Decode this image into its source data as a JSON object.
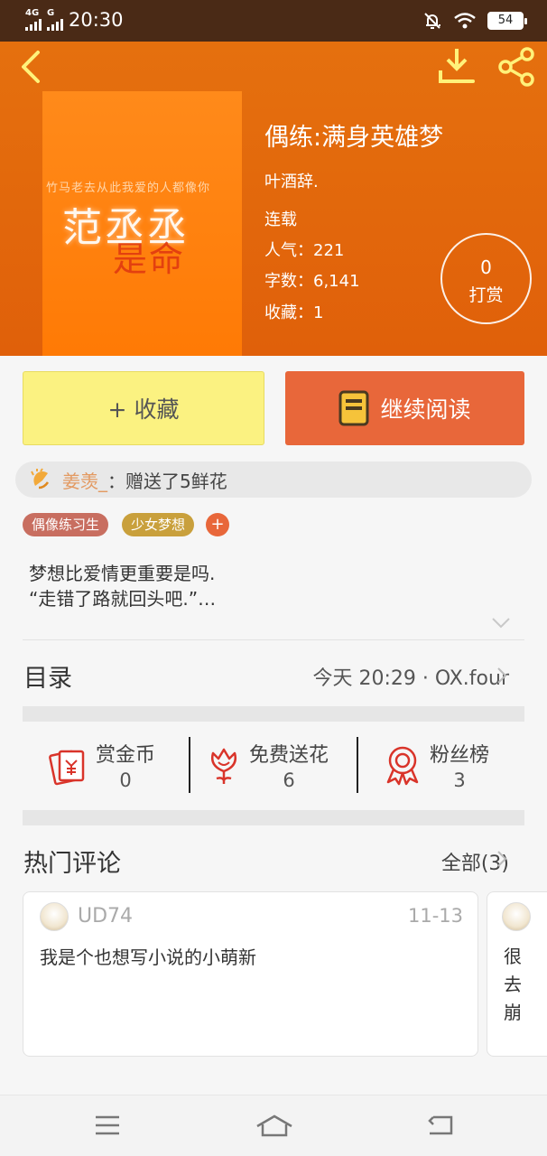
{
  "status_bar": {
    "network_1": "4G",
    "network_2": "G",
    "time": "20:30",
    "battery": "54"
  },
  "book": {
    "cover": {
      "sub_text": "竹马老去从此我爱的人都像你",
      "main_text": "范丞丞",
      "red_text": "是命"
    },
    "title": "偶练:满身英雄梦",
    "author": "叶酒辞.",
    "status": "连载",
    "popularity": "人气：221",
    "word_count": "字数：6,141",
    "favorites": "收藏：1",
    "reward": {
      "count": "0",
      "label": "打赏"
    }
  },
  "actions": {
    "favorite_label": "+ 收藏",
    "read_label": "继续阅读"
  },
  "gift_strip": {
    "user": "姜羡_",
    "text": "：赠送了5鲜花"
  },
  "tags": [
    {
      "label": "偶像练习生",
      "color": "#c86e60"
    },
    {
      "label": "少女梦想",
      "color": "#c9a03c"
    }
  ],
  "tag_add": "+",
  "intro": {
    "line1": "梦想比爱情更重要是吗.",
    "line2": "“走错了路就回头吧.”…"
  },
  "toc": {
    "title": "目录",
    "latest": "今天 20:29 · OX.four"
  },
  "stats": [
    {
      "label": "赏金币",
      "value": "0",
      "icon": "red-envelope-icon"
    },
    {
      "label": "免费送花",
      "value": "6",
      "icon": "flower-icon"
    },
    {
      "label": "粉丝榜",
      "value": "3",
      "icon": "medal-icon"
    }
  ],
  "comments": {
    "title": "热门评论",
    "all_label": "全部(3)",
    "items": [
      {
        "user": "UD74",
        "date": "11-13",
        "text": "我是个也想写小说的小萌新"
      },
      {
        "text": "很去崩"
      }
    ]
  },
  "colors": {
    "header": "#e5700e",
    "accent": "#e8673a",
    "favorite_bg": "#fbf281"
  }
}
